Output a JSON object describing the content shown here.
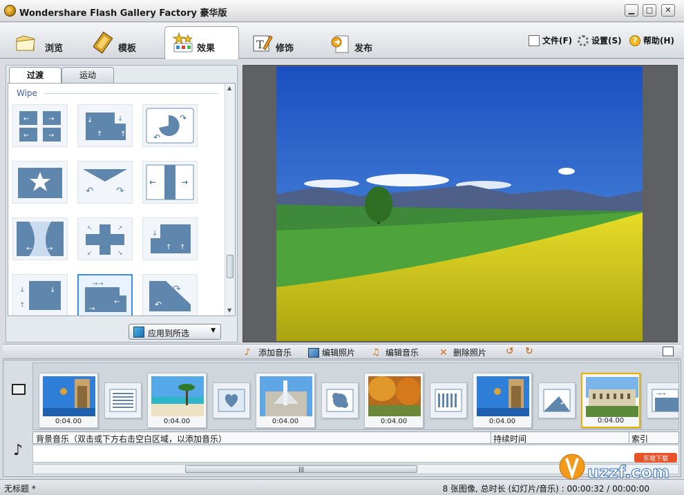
{
  "window": {
    "title": "Wondershare Flash Gallery Factory 豪华版",
    "min": "▁",
    "max": "□",
    "close": "✕"
  },
  "tabs": [
    {
      "label": "浏览",
      "icon": "folder-icon"
    },
    {
      "label": "模板",
      "icon": "film-icon"
    },
    {
      "label": "效果",
      "icon": "stars-icon"
    },
    {
      "label": "修饰",
      "icon": "edit-pencil-icon"
    },
    {
      "label": "发布",
      "icon": "publish-document-icon"
    }
  ],
  "menu": {
    "file": "文件(F)",
    "settings": "设置(S)",
    "help": "帮助(H)"
  },
  "left_panel": {
    "subtabs": [
      "过渡",
      "运动"
    ],
    "group_label": "Wipe",
    "apply_button": "应用到所选"
  },
  "toolbar": {
    "add_music": "添加音乐",
    "edit_photo": "编辑照片",
    "edit_music": "编辑音乐",
    "delete_photo": "删除照片"
  },
  "storyboard": {
    "durations": [
      "0:04.00",
      "0:04.00",
      "0:04.00",
      "0:04.00",
      "0:04.00",
      "0:04.00"
    ]
  },
  "music": {
    "hint": "背景音乐（双击或下方右击空白区域，以添加音乐）",
    "duration_col": "持续时间",
    "index_col": "索引"
  },
  "status": {
    "left": "无标题 *",
    "right": "8 张图像, 总时长 (幻灯片/音乐) : 00:00:32 / 00:00:00"
  },
  "watermark": {
    "text": "uzzf.com",
    "sub": "东坡下载"
  },
  "colors": {
    "accent": "#3b8ee8",
    "selected_slide": "#e9b100",
    "effect_blue": "#5f86ad"
  }
}
